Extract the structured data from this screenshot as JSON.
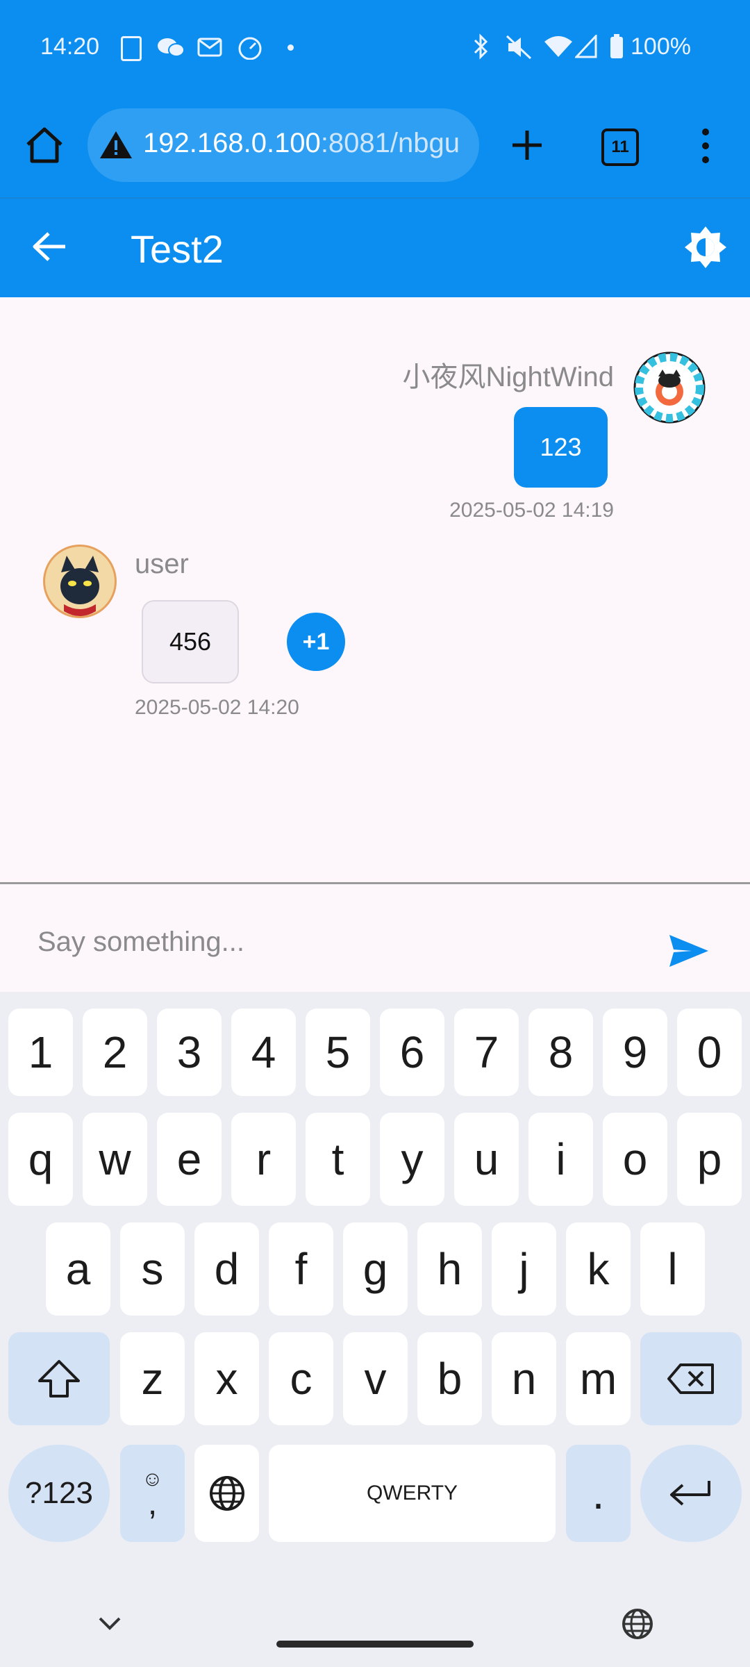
{
  "status_bar": {
    "time": "14:20",
    "battery": "100%"
  },
  "browser": {
    "url_host": "192.168.0.100",
    "url_rest": ":8081/nbgu",
    "tab_count": "11"
  },
  "app_bar": {
    "title": "Test2"
  },
  "messages": [
    {
      "sender": "小夜风NightWind",
      "text": "123",
      "timestamp": "2025-05-02 14:19",
      "self": true
    },
    {
      "sender": "user",
      "text": "456",
      "timestamp": "2025-05-02 14:20",
      "self": false,
      "reaction": "+1"
    }
  ],
  "composer": {
    "placeholder": "Say something..."
  },
  "keyboard": {
    "row1": [
      "1",
      "2",
      "3",
      "4",
      "5",
      "6",
      "7",
      "8",
      "9",
      "0"
    ],
    "row2": [
      "q",
      "w",
      "e",
      "r",
      "t",
      "y",
      "u",
      "i",
      "o",
      "p"
    ],
    "row3": [
      "a",
      "s",
      "d",
      "f",
      "g",
      "h",
      "j",
      "k",
      "l"
    ],
    "row4": [
      "z",
      "x",
      "c",
      "v",
      "b",
      "n",
      "m"
    ],
    "symbols": "?123",
    "comma": ",",
    "space": "QWERTY",
    "period": "."
  },
  "colors": {
    "primary": "#0b8ef0",
    "background": "#fdf7fb",
    "keyboard_bg": "#eceef3",
    "key_fn": "#d4e2f5"
  }
}
